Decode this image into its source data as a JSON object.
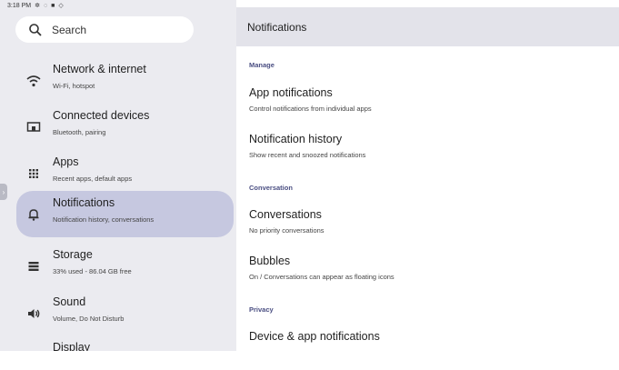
{
  "status_bar": {
    "time": "3:18 PM",
    "icons": [
      "gear-icon",
      "location-icon",
      "storage-icon",
      "shield-icon"
    ]
  },
  "search": {
    "placeholder": "Search"
  },
  "sidebar": {
    "items": [
      {
        "title": "Network & internet",
        "subtitle": "Wi-Fi, hotspot",
        "icon": "wifi-icon"
      },
      {
        "title": "Connected devices",
        "subtitle": "Bluetooth, pairing",
        "icon": "connected-devices-icon"
      },
      {
        "title": "Apps",
        "subtitle": "Recent apps, default apps",
        "icon": "apps-grid-icon"
      },
      {
        "title": "Notifications",
        "subtitle": "Notification history, conversations",
        "icon": "bell-icon",
        "selected": true
      },
      {
        "title": "Storage",
        "subtitle": "33% used - 86.04 GB free",
        "icon": "storage-icon"
      },
      {
        "title": "Sound",
        "subtitle": "Volume, Do Not Disturb",
        "icon": "volume-icon"
      },
      {
        "title": "Display",
        "subtitle": "",
        "icon": "display-icon"
      }
    ]
  },
  "header": {
    "title": "Notifications"
  },
  "sections": {
    "manage": "Manage",
    "conversation": "Conversation",
    "privacy": "Privacy"
  },
  "prefs": {
    "app_notifications": {
      "title": "App notifications",
      "subtitle": "Control notifications from individual apps"
    },
    "notification_history": {
      "title": "Notification history",
      "subtitle": "Show recent and snoozed notifications"
    },
    "conversations": {
      "title": "Conversations",
      "subtitle": "No priority conversations"
    },
    "bubbles": {
      "title": "Bubbles",
      "subtitle": "On / Conversations can appear as floating icons"
    },
    "device_app_notifications": {
      "title": "Device & app notifications",
      "subtitle": ""
    }
  },
  "colors": {
    "sidebar_bg": "#ebebf0",
    "selected_bg": "#c6c8e0",
    "header_bg": "#e3e3ea",
    "section_label": "#4a4e82"
  }
}
